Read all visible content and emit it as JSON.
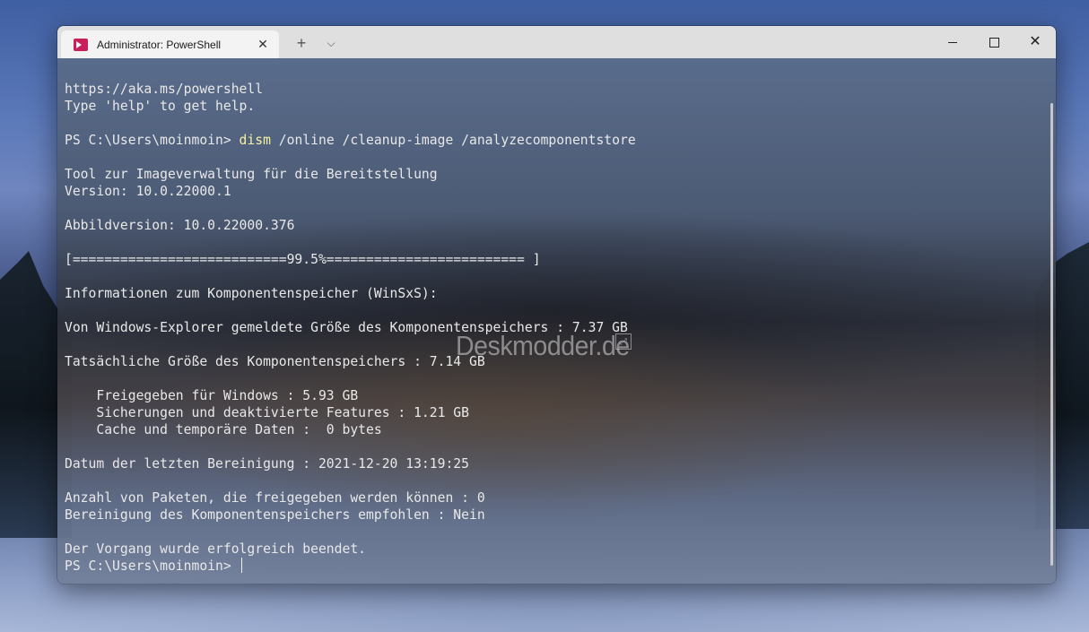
{
  "window": {
    "tab_title": "Administrator: PowerShell",
    "tab_close_glyph": "✕",
    "new_tab_glyph": "+",
    "dropdown_glyph": "⌵",
    "close_glyph": "✕"
  },
  "console": {
    "lines": [
      "https://aka.ms/powershell",
      "Type 'help' to get help.",
      "",
      {
        "prompt": "PS C:\\Users\\moinmoin> ",
        "cmd": "dism",
        "args": " /online /cleanup-image /analyzecomponentstore"
      },
      "",
      "Tool zur Imageverwaltung für die Bereitstellung",
      "Version: 10.0.22000.1",
      "",
      "Abbildversion: 10.0.22000.376",
      "",
      "[===========================99.5%========================= ]",
      "",
      "Informationen zum Komponentenspeicher (WinSxS):",
      "",
      "Von Windows-Explorer gemeldete Größe des Komponentenspeichers : 7.37 GB",
      "",
      "Tatsächliche Größe des Komponentenspeichers : 7.14 GB",
      "",
      "    Freigegeben für Windows : 5.93 GB",
      "    Sicherungen und deaktivierte Features : 1.21 GB",
      "    Cache und temporäre Daten :  0 bytes",
      "",
      "Datum der letzten Bereinigung : 2021-12-20 13:19:25",
      "",
      "Anzahl von Paketen, die freigegeben werden können : 0",
      "Bereinigung des Komponentenspeichers empfohlen : Nein",
      "",
      "Der Vorgang wurde erfolgreich beendet.",
      {
        "prompt": "PS C:\\Users\\moinmoin> ",
        "cursor": true
      }
    ]
  },
  "watermark": {
    "text": "Deskmodder.de",
    "badge_glyph": "⤢"
  }
}
